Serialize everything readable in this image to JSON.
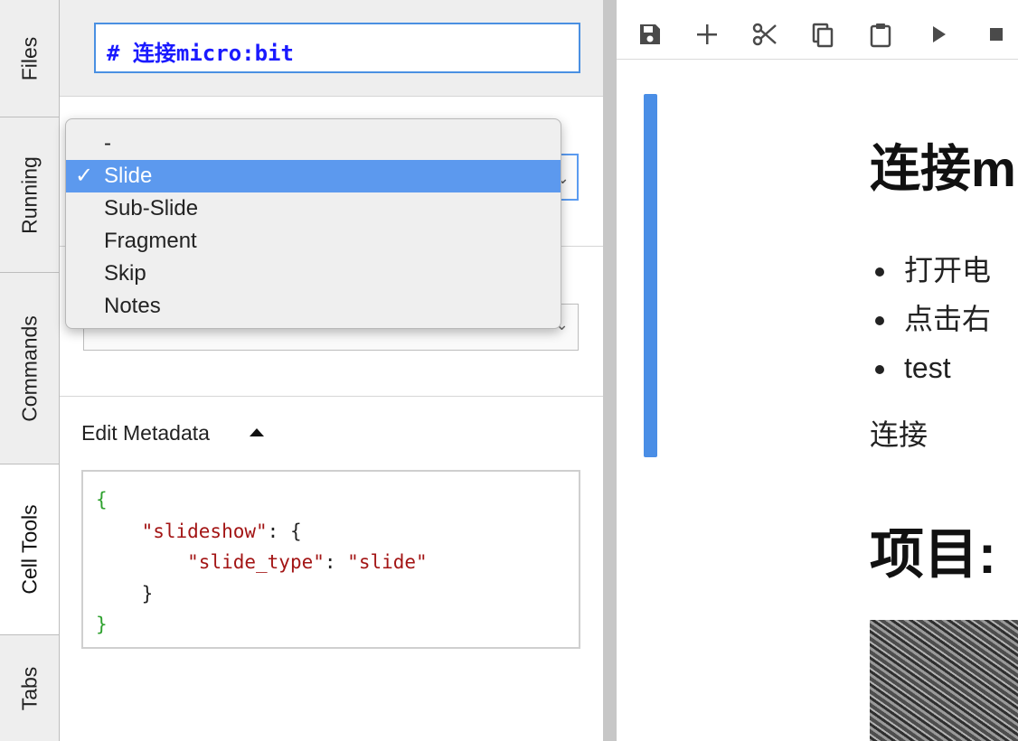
{
  "left_tabs": [
    {
      "label": "Files",
      "active": false
    },
    {
      "label": "Running",
      "active": false
    },
    {
      "label": "Commands",
      "active": false
    },
    {
      "label": "Cell Tools",
      "active": true
    },
    {
      "label": "Tabs",
      "active": false
    }
  ],
  "cell_tools": {
    "cell_preview": "# 连接micro:bit",
    "slide_type": {
      "options": [
        "-",
        "Slide",
        "Sub-Slide",
        "Fragment",
        "Skip",
        "Notes"
      ],
      "selected": "Slide",
      "check_glyph": "✓"
    },
    "edit_metadata": {
      "label": "Edit Metadata",
      "expanded": true,
      "json_lines": {
        "open_brace": "{",
        "key1": "\"slideshow\"",
        "colon_brace": ": {",
        "key2": "\"slide_type\"",
        "colon": ": ",
        "value2": "\"slide\"",
        "close_inner": "}",
        "close_outer": "}"
      }
    }
  },
  "notebook": {
    "toolbar_icons": [
      "save-icon",
      "add-icon",
      "cut-icon",
      "copy-icon",
      "paste-icon",
      "run-icon",
      "stop-icon"
    ],
    "heading1": "连接m",
    "list_items": [
      "打开电",
      "点击右",
      "test"
    ],
    "paragraph": "连接",
    "heading2": "项目:"
  },
  "colors": {
    "accent": "#4a8ee6",
    "selected_option": "#5c99ee",
    "json_brace": "#2ea12e",
    "json_string": "#a31515",
    "cell_preview_text": "#1a1aff"
  }
}
